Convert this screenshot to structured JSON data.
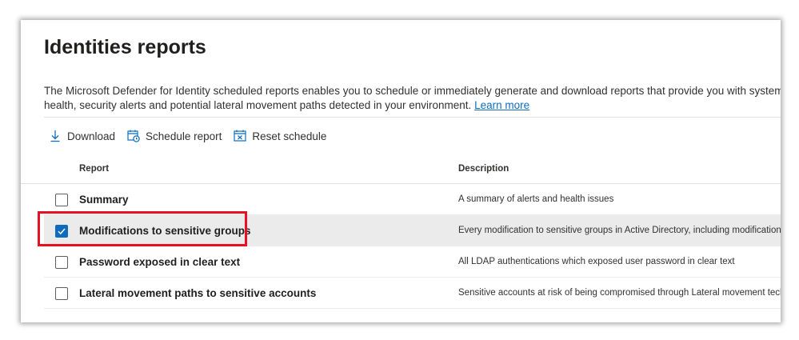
{
  "page": {
    "title": "Identities reports",
    "description_line1": "The Microsoft Defender for Identity scheduled reports enables you to schedule or immediately generate and download reports that provide you with system and en",
    "description_line2": "health, security alerts and potential lateral movement paths detected in your environment.",
    "learn_more": "Learn more"
  },
  "toolbar": {
    "download": "Download",
    "schedule": "Schedule report",
    "reset": "Reset schedule"
  },
  "table": {
    "headers": [
      "Report",
      "Description"
    ],
    "rows": [
      {
        "name": "Summary",
        "description": "A summary of alerts and health issues",
        "checked": false
      },
      {
        "name": "Modifications to sensitive groups",
        "description": "Every modification to sensitive groups in Active Directory, including modifications...",
        "checked": true
      },
      {
        "name": "Password exposed in clear text",
        "description": "All LDAP authentications which exposed user password in clear text",
        "checked": false
      },
      {
        "name": "Lateral movement paths to sensitive accounts",
        "description": "Sensitive accounts at risk of being compromised through Lateral movement tech...",
        "checked": false
      }
    ]
  },
  "colors": {
    "accent": "#0f6cbd",
    "highlight_box": "#e81123",
    "selected_row": "#ebebeb"
  }
}
